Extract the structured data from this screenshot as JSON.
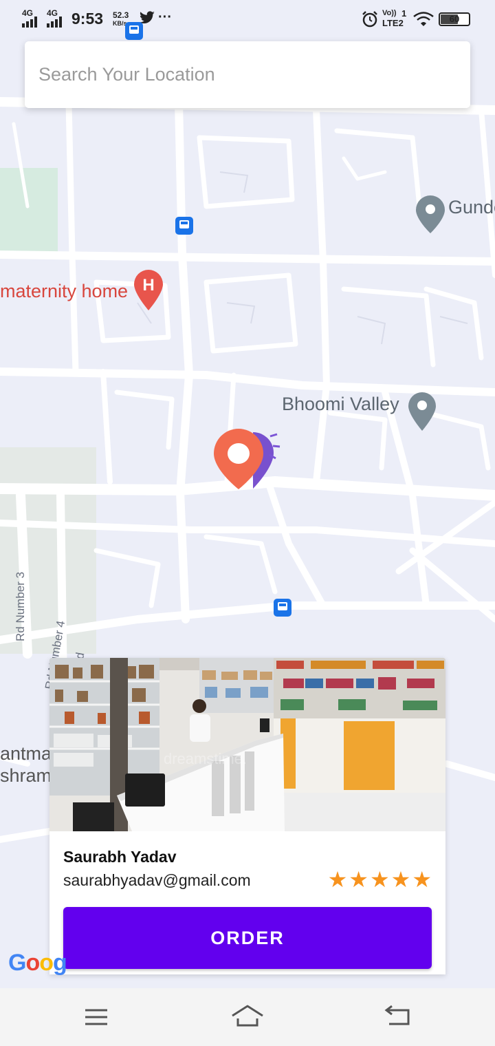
{
  "status_bar": {
    "network_1": "4G",
    "network_2": "4G",
    "time": "9:53",
    "data_rate": "52.3",
    "data_unit": "KB/s",
    "volte": "Vo))",
    "lte": "LTE2",
    "sim_index": "1",
    "battery": "60",
    "more": "···"
  },
  "search": {
    "placeholder": "Search Your Location"
  },
  "map": {
    "labels": {
      "gundecha": "Gunde",
      "maternity_home": "maternity home",
      "bhoomi_valley": "Bhoomi Valley",
      "rd_number_3": "Rd Number 3",
      "rd_number_4": "Rd Number 4",
      "rd_partial": "Rd",
      "left_edge_1": "antma",
      "left_edge_2": "shram"
    },
    "pin_color": "#f26b4e",
    "hospital_color": "#e8554c",
    "poi_marker_color": "#7b8b95",
    "bus_stop_color": "#1a73e8"
  },
  "store_card": {
    "owner_name": "Saurabh Yadav",
    "owner_email": "saurabhyadav@gmail.com",
    "rating": 5,
    "rating_max": 5,
    "order_label": "ORDER",
    "accent_color": "#6200ee",
    "star_color": "#f7931e"
  },
  "google_logo": {
    "text": "Goog"
  }
}
